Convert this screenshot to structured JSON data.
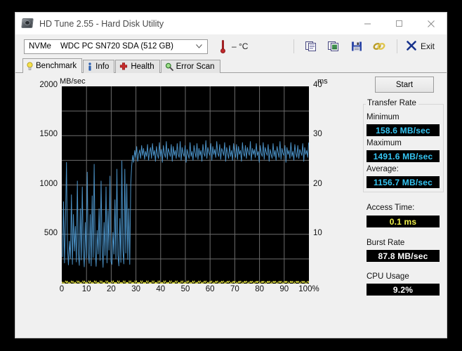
{
  "window": {
    "title": "HD Tune 2.55 - Hard Disk Utility",
    "app_icon": "hard-disk-icon",
    "controls": {
      "minimize": "–",
      "maximize": "▢",
      "close": "✕"
    }
  },
  "toolbar": {
    "drive": {
      "type": "NVMe",
      "model": "WDC PC SN720 SDA (512 GB)"
    },
    "temperature": "– °C",
    "buttons": [
      {
        "name": "copy-icon",
        "label": "Copy"
      },
      {
        "name": "copy-screenshot-icon",
        "label": "Copy screenshot"
      },
      {
        "name": "save-icon",
        "label": "Save"
      },
      {
        "name": "link-icon",
        "label": "Link"
      }
    ],
    "exit_label": "Exit"
  },
  "tabs": [
    {
      "label": "Benchmark",
      "icon": "lightbulb-icon",
      "active": true
    },
    {
      "label": "Info",
      "icon": "info-icon",
      "active": false
    },
    {
      "label": "Health",
      "icon": "health-cross-icon",
      "active": false
    },
    {
      "label": "Error Scan",
      "icon": "magnifier-icon",
      "active": false
    }
  ],
  "panel": {
    "start_label": "Start",
    "transfer_rate": {
      "group_title": "Transfer Rate",
      "minimum_label": "Minimum",
      "minimum_value": "158.6 MB/sec",
      "maximum_label": "Maximum",
      "maximum_value": "1491.6 MB/sec",
      "average_label": "Average:",
      "average_value": "1156.7 MB/sec"
    },
    "access_time_label": "Access Time:",
    "access_time_value": "0.1 ms",
    "burst_rate_label": "Burst Rate",
    "burst_rate_value": "87.8 MB/sec",
    "cpu_usage_label": "CPU Usage",
    "cpu_usage_value": "9.2%"
  },
  "colors": {
    "transfer_line": "#4a90c4",
    "access_dots": "#f2f24a",
    "lcd_cyan": "#35c6f4",
    "lcd_yellow": "#f2f24a",
    "lcd_white": "#ffffff",
    "plot_bg": "#000000",
    "grid": "#6d6d6d"
  },
  "chart_data": {
    "type": "line",
    "title": "",
    "xlabel": "",
    "ylabel": "MB/sec",
    "y2label": "ms",
    "xlim": [
      0,
      100
    ],
    "ylim": [
      0,
      2000
    ],
    "y2lim": [
      0,
      40
    ],
    "grid": true,
    "xticks": [
      "0",
      "10",
      "20",
      "30",
      "40",
      "50",
      "60",
      "70",
      "80",
      "90",
      "100%"
    ],
    "xtick_values": [
      0,
      10,
      20,
      30,
      40,
      50,
      60,
      70,
      80,
      90,
      100
    ],
    "yticks": [
      "2000",
      "1500",
      "1000",
      "500"
    ],
    "ytick_values": [
      2000,
      1500,
      1000,
      500
    ],
    "y2ticks": [
      "40",
      "30",
      "20",
      "10"
    ],
    "y2tick_values": [
      40,
      30,
      20,
      10
    ],
    "series": [
      {
        "name": "Transfer rate",
        "unit": "MB/sec",
        "axis": "left",
        "color": "#4a90c4",
        "min": 158.6,
        "max": 1491.6,
        "average": 1156.7,
        "x": [
          0.3,
          0.7,
          1.1,
          1.5,
          1.9,
          2.3,
          2.7,
          3.1,
          3.5,
          3.9,
          4.3,
          4.7,
          5.1,
          5.5,
          5.9,
          6.3,
          6.7,
          7.1,
          7.5,
          7.9,
          8.3,
          8.7,
          9.1,
          9.5,
          9.9,
          10.3,
          10.7,
          11.1,
          11.5,
          11.9,
          12.3,
          12.7,
          13.1,
          13.5,
          13.9,
          14.3,
          14.7,
          15.1,
          15.5,
          15.9,
          16.3,
          16.7,
          17.1,
          17.5,
          17.9,
          18.3,
          18.7,
          19.1,
          19.5,
          19.9,
          20.3,
          20.7,
          21.1,
          21.5,
          21.9,
          22.3,
          22.7,
          23.1,
          23.5,
          23.9,
          24.3,
          24.7,
          25.1,
          25.5,
          25.9,
          26.3,
          26.7,
          27.1,
          27.5,
          27.9,
          28.3,
          28.7,
          29.1,
          29.5,
          29.9,
          30.3,
          30.7,
          31.1,
          31.5,
          31.9,
          32.3,
          32.7,
          33.1,
          33.5,
          33.9,
          34.3,
          34.7,
          35.1,
          35.5,
          35.9,
          36.3,
          36.7,
          37.1,
          37.5,
          37.9,
          38.3,
          38.7,
          39.1,
          39.5,
          39.9,
          40.3,
          40.7,
          41.1,
          41.5,
          41.9,
          42.3,
          42.7,
          43.1,
          43.5,
          43.9,
          44.3,
          44.7,
          45.1,
          45.5,
          45.9,
          46.3,
          46.7,
          47.1,
          47.5,
          47.9,
          48.3,
          48.7,
          49.1,
          49.5,
          49.9,
          50.3,
          50.7,
          51.1,
          51.5,
          51.9,
          52.3,
          52.7,
          53.1,
          53.5,
          53.9,
          54.3,
          54.7,
          55.1,
          55.5,
          55.9,
          56.3,
          56.7,
          57.1,
          57.5,
          57.9,
          58.3,
          58.7,
          59.1,
          59.5,
          59.9,
          60.3,
          60.7,
          61.1,
          61.5,
          61.9,
          62.3,
          62.7,
          63.1,
          63.5,
          63.9,
          64.3,
          64.7,
          65.1,
          65.5,
          65.9,
          66.3,
          66.7,
          67.1,
          67.5,
          67.9,
          68.3,
          68.7,
          69.1,
          69.5,
          69.9,
          70.3,
          70.7,
          71.1,
          71.5,
          71.9,
          72.3,
          72.7,
          73.1,
          73.5,
          73.9,
          74.3,
          74.7,
          75.1,
          75.5,
          75.9,
          76.3,
          76.7,
          77.1,
          77.5,
          77.9,
          78.3,
          78.7,
          79.1,
          79.5,
          79.9,
          80.3,
          80.7,
          81.1,
          81.5,
          81.9,
          82.3,
          82.7,
          83.1,
          83.5,
          83.9,
          84.3,
          84.7,
          85.1,
          85.5,
          85.9,
          86.3,
          86.7,
          87.1,
          87.5,
          87.9,
          88.3,
          88.7,
          89.1,
          89.5,
          89.9,
          90.3,
          90.7,
          91.1,
          91.5,
          91.9,
          92.3,
          92.7,
          93.1,
          93.5,
          93.9,
          94.3,
          94.7,
          95.1,
          95.5,
          95.9,
          96.3,
          96.7,
          97.1,
          97.5,
          97.9,
          98.3,
          98.7,
          99.1,
          99.5,
          99.9
        ],
        "y": [
          270,
          830,
          210,
          640,
          1230,
          360,
          190,
          430,
          255,
          900,
          195,
          700,
          330,
          580,
          220,
          1040,
          300,
          185,
          760,
          240,
          980,
          350,
          170,
          620,
          260,
          1130,
          310,
          205,
          700,
          180,
          890,
          265,
          1210,
          330,
          175,
          540,
          300,
          760,
          235,
          1040,
          390,
          165,
          620,
          285,
          980,
          210,
          740,
          340,
          1090,
          225,
          195,
          520,
          300,
          850,
          250,
          1160,
          290,
          180,
          660,
          215,
          1245,
          340,
          200,
          1160,
          310,
          1010,
          245,
          760,
          195,
          1010,
          1200,
          1300,
          1230,
          1350,
          1280,
          1390,
          1240,
          1310,
          1355,
          1270,
          1400,
          1300,
          1370,
          1260,
          1340,
          1290,
          1410,
          1250,
          1330,
          1380,
          1270,
          1420,
          1300,
          1350,
          1240,
          1390,
          1310,
          1270,
          1430,
          1290,
          1360,
          1230,
          1400,
          1320,
          1280,
          1440,
          1260,
          1370,
          1330,
          1290,
          1410,
          1240,
          1390,
          1300,
          1350,
          1270,
          1420,
          1310,
          1280,
          1440,
          1250,
          1380,
          1320,
          1290,
          1400,
          1230,
          1360,
          1310,
          1270,
          1430,
          1290,
          1340,
          1250,
          1400,
          1330,
          1280,
          1420,
          1260,
          1370,
          1300,
          1350,
          1240,
          1410,
          1320,
          1290,
          1450,
          1270,
          1380,
          1330,
          1300,
          1420,
          1250,
          1390,
          1310,
          1360,
          1280,
          1440,
          1320,
          1290,
          1410,
          1260,
          1370,
          1340,
          1300,
          1430,
          1240,
          1380,
          1320,
          1270,
          1400,
          1290,
          1350,
          1250,
          1420,
          1330,
          1280,
          1410,
          1260,
          1390,
          1310,
          1350,
          1240,
          1430,
          1320,
          1290,
          1400,
          1270,
          1380,
          1330,
          1300,
          1440,
          1250,
          1370,
          1310,
          1360,
          1280,
          1420,
          1300,
          1340,
          1230,
          1400,
          1320,
          1290,
          1430,
          1260,
          1380,
          1330,
          1300,
          1410,
          1240,
          1360,
          1310,
          1270,
          1420,
          1290,
          1350,
          1250,
          1390,
          1330,
          1280,
          1440,
          1260,
          1370,
          1320,
          1300,
          1400,
          1230,
          1380,
          1310,
          1350,
          1270,
          1430,
          1290,
          1340,
          1250,
          1410,
          1320,
          1280,
          1400,
          1270,
          1360,
          1330,
          1300,
          1420,
          1240,
          1380,
          1310,
          1350,
          1280,
          1430,
          1300
        ]
      },
      {
        "name": "Access time",
        "unit": "ms",
        "axis": "right",
        "color": "#f2f24a",
        "value": 0.1
      }
    ]
  }
}
